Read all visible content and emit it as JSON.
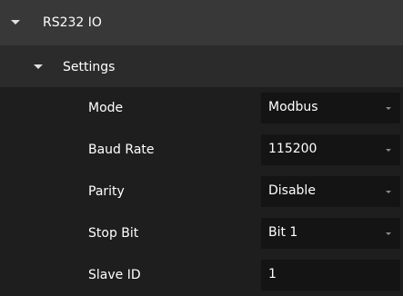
{
  "header": {
    "title": "RS232 IO",
    "toggle_icon": "chevron-down-icon"
  },
  "settings": {
    "title": "Settings",
    "toggle_icon": "chevron-down-icon",
    "rows": [
      {
        "label": "Mode",
        "value": "Modbus",
        "type": "dropdown"
      },
      {
        "label": "Baud Rate",
        "value": "115200",
        "type": "dropdown"
      },
      {
        "label": "Parity",
        "value": "Disable",
        "type": "dropdown"
      },
      {
        "label": "Stop Bit",
        "value": "Bit 1",
        "type": "dropdown"
      },
      {
        "label": "Slave ID",
        "value": "1",
        "type": "text"
      }
    ]
  },
  "colors": {
    "background": "#1e1e1e",
    "header_bg": "#383838",
    "subheader_bg": "#2b2b2b",
    "field_bg": "#141414",
    "text": "#ffffff"
  }
}
